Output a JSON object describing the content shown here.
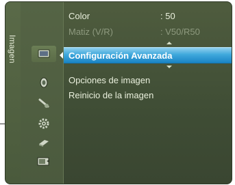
{
  "sidebar": {
    "tab_label": "Imagen",
    "icons": [
      {
        "name": "picture-icon",
        "selected": true
      },
      {
        "name": "sound-icon",
        "selected": false
      },
      {
        "name": "channel-icon",
        "selected": false
      },
      {
        "name": "setup-gear-icon",
        "selected": false
      },
      {
        "name": "input-icon",
        "selected": false
      },
      {
        "name": "application-icon",
        "selected": false
      }
    ]
  },
  "menu": {
    "items": [
      {
        "label": "Color",
        "value": ": 50",
        "state": "normal"
      },
      {
        "label": "Matiz (V/R)",
        "value": ": V50/R50",
        "state": "dim"
      },
      {
        "label": "Configuración Avanzada",
        "value": "",
        "state": "highlight"
      },
      {
        "label": "Opciones de imagen",
        "value": "",
        "state": "normal"
      },
      {
        "label": "Reinicio de la imagen",
        "value": "",
        "state": "normal"
      }
    ]
  },
  "colors": {
    "background": "#4a573b",
    "highlight": "#2d96d3",
    "text": "#eaf0dd",
    "dim_text": "#8e9a7f"
  }
}
